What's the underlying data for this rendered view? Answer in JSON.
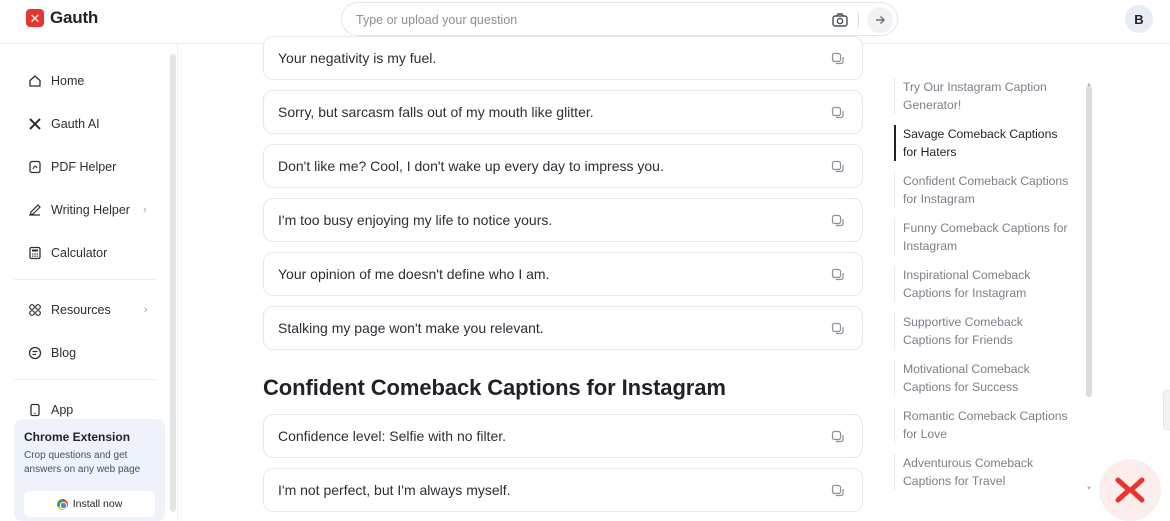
{
  "brand": {
    "name": "Gauth",
    "mark": "✕",
    "color": "#e8362f"
  },
  "search": {
    "placeholder": "Type or upload your question"
  },
  "user": {
    "initial": "B"
  },
  "sidebar": {
    "items": [
      {
        "label": "Home",
        "icon": "home-icon"
      },
      {
        "label": "Gauth AI",
        "icon": "gauth-ai-icon"
      },
      {
        "label": "PDF Helper",
        "icon": "pdf-icon"
      },
      {
        "label": "Writing Helper",
        "icon": "pen-icon",
        "chevron": "›"
      },
      {
        "label": "Calculator",
        "icon": "calculator-icon"
      },
      {
        "label": "Resources",
        "icon": "grid-icon",
        "chevron": "›"
      },
      {
        "label": "Blog",
        "icon": "blog-icon"
      },
      {
        "label": "App",
        "icon": "phone-icon"
      }
    ],
    "chrome_extension": {
      "title": "Chrome Extension",
      "description": "Crop questions and get answers on any web page",
      "button": "Install now"
    }
  },
  "captions_top": [
    "Your negativity is my fuel.",
    "Sorry, but sarcasm falls out of my mouth like glitter.",
    "Don't like me? Cool, I don't wake up every day to impress you.",
    "I'm too busy enjoying my life to notice yours.",
    "Your opinion of me doesn't define who I am.",
    "Stalking my page won't make you relevant."
  ],
  "section": {
    "title": "Confident Comeback Captions for Instagram"
  },
  "captions_bottom": [
    "Confidence level: Selfie with no filter.",
    "I'm not perfect, but I'm always myself."
  ],
  "toc": [
    {
      "line1": "Try Our Instagram Caption",
      "line2": "Generator!"
    },
    {
      "line1": "Savage Comeback Captions",
      "line2": "for Haters",
      "active": true
    },
    {
      "line1": "Confident Comeback Captions",
      "line2": "for Instagram"
    },
    {
      "line1": "Funny Comeback Captions for",
      "line2": "Instagram"
    },
    {
      "line1": "Inspirational Comeback",
      "line2": "Captions for Instagram"
    },
    {
      "line1": "Supportive Comeback",
      "line2": "Captions for Friends"
    },
    {
      "line1": "Motivational Comeback",
      "line2": "Captions for Success"
    },
    {
      "line1": "Romantic Comeback Captions",
      "line2": "for Love"
    },
    {
      "line1": "Adventurous Comeback",
      "line2": "Captions for Travel"
    }
  ]
}
